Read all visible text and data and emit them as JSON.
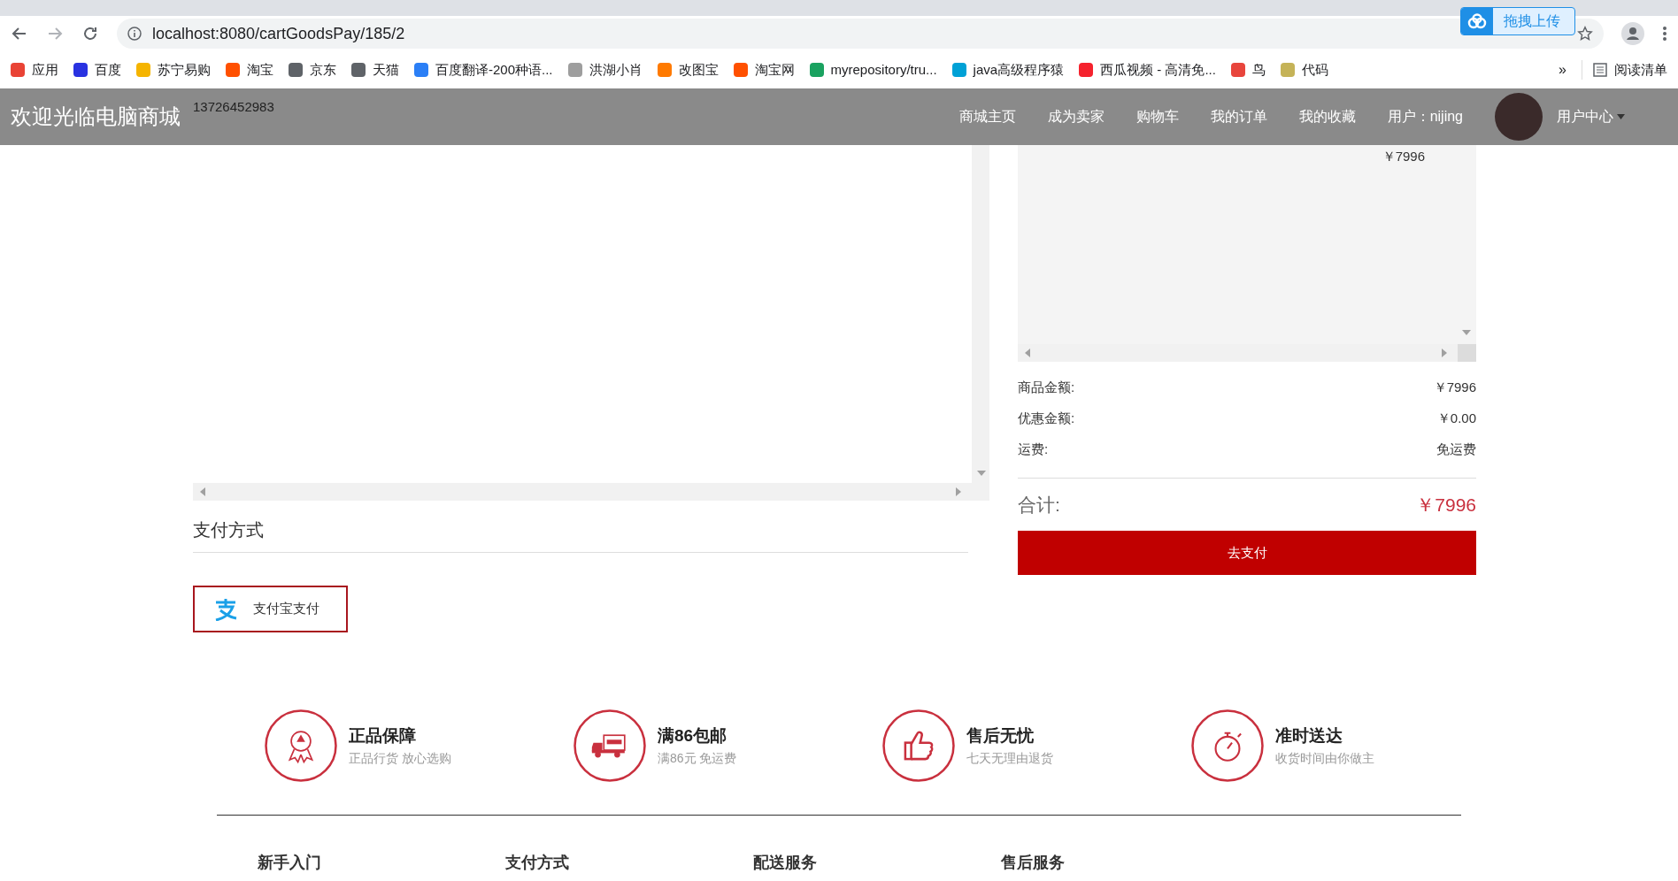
{
  "browser": {
    "url": "localhost:8080/cartGoodsPay/185/2",
    "upload_button": "拖拽上传",
    "bookmarks": [
      {
        "label": "应用",
        "color": "#e94335"
      },
      {
        "label": "百度",
        "color": "#2932e1"
      },
      {
        "label": "苏宁易购",
        "color": "#f5b400"
      },
      {
        "label": "淘宝",
        "color": "#ff5000"
      },
      {
        "label": "京东",
        "color": "#5f6368"
      },
      {
        "label": "天猫",
        "color": "#5f6368"
      },
      {
        "label": "百度翻译-200种语...",
        "color": "#2b7ff6"
      },
      {
        "label": "洪湖小肖",
        "color": "#9e9e9e"
      },
      {
        "label": "改图宝",
        "color": "#ff7a00"
      },
      {
        "label": "淘宝网",
        "color": "#ff5000"
      },
      {
        "label": "myrepository/tru...",
        "color": "#1aa260"
      },
      {
        "label": "java高级程序猿",
        "color": "#00a1d6"
      },
      {
        "label": "西瓜视频 - 高清免...",
        "color": "#f5222d"
      },
      {
        "label": "鸟",
        "color": "#e8453c"
      },
      {
        "label": "代码",
        "color": "#c5b358"
      }
    ],
    "more": "»",
    "reading_list": "阅读清单"
  },
  "nav": {
    "brand": "欢迎光临电脑商城",
    "links": [
      "商城主页",
      "成为卖家",
      "购物车",
      "我的订单",
      "我的收藏",
      "用户：nijing"
    ],
    "user_menu": "用户中心"
  },
  "address": {
    "phone": "13726452983"
  },
  "goods": {
    "price": "￥7996"
  },
  "payment": {
    "title": "支付方式",
    "methods": [
      {
        "label": "支付宝支付",
        "selected": true
      }
    ]
  },
  "summary": {
    "rows": [
      {
        "label": "商品金额:",
        "value": "￥7996"
      },
      {
        "label": "优惠金额:",
        "value": "￥0.00"
      },
      {
        "label": "运费:",
        "value": "免运费"
      }
    ],
    "total_label": "合计:",
    "total_value": "￥7996",
    "pay_button": "去支付"
  },
  "features": [
    {
      "kind": "medal",
      "title": "正品保障",
      "subtitle": "正品行货 放心选购"
    },
    {
      "kind": "truck",
      "title": "满86包邮",
      "subtitle": "满86元 免运费"
    },
    {
      "kind": "thumb",
      "title": "售后无忧",
      "subtitle": "七天无理由退货"
    },
    {
      "kind": "timer",
      "title": "准时送达",
      "subtitle": "收货时间由你做主"
    }
  ],
  "footer": [
    "新手入门",
    "支付方式",
    "配送服务",
    "售后服务"
  ]
}
